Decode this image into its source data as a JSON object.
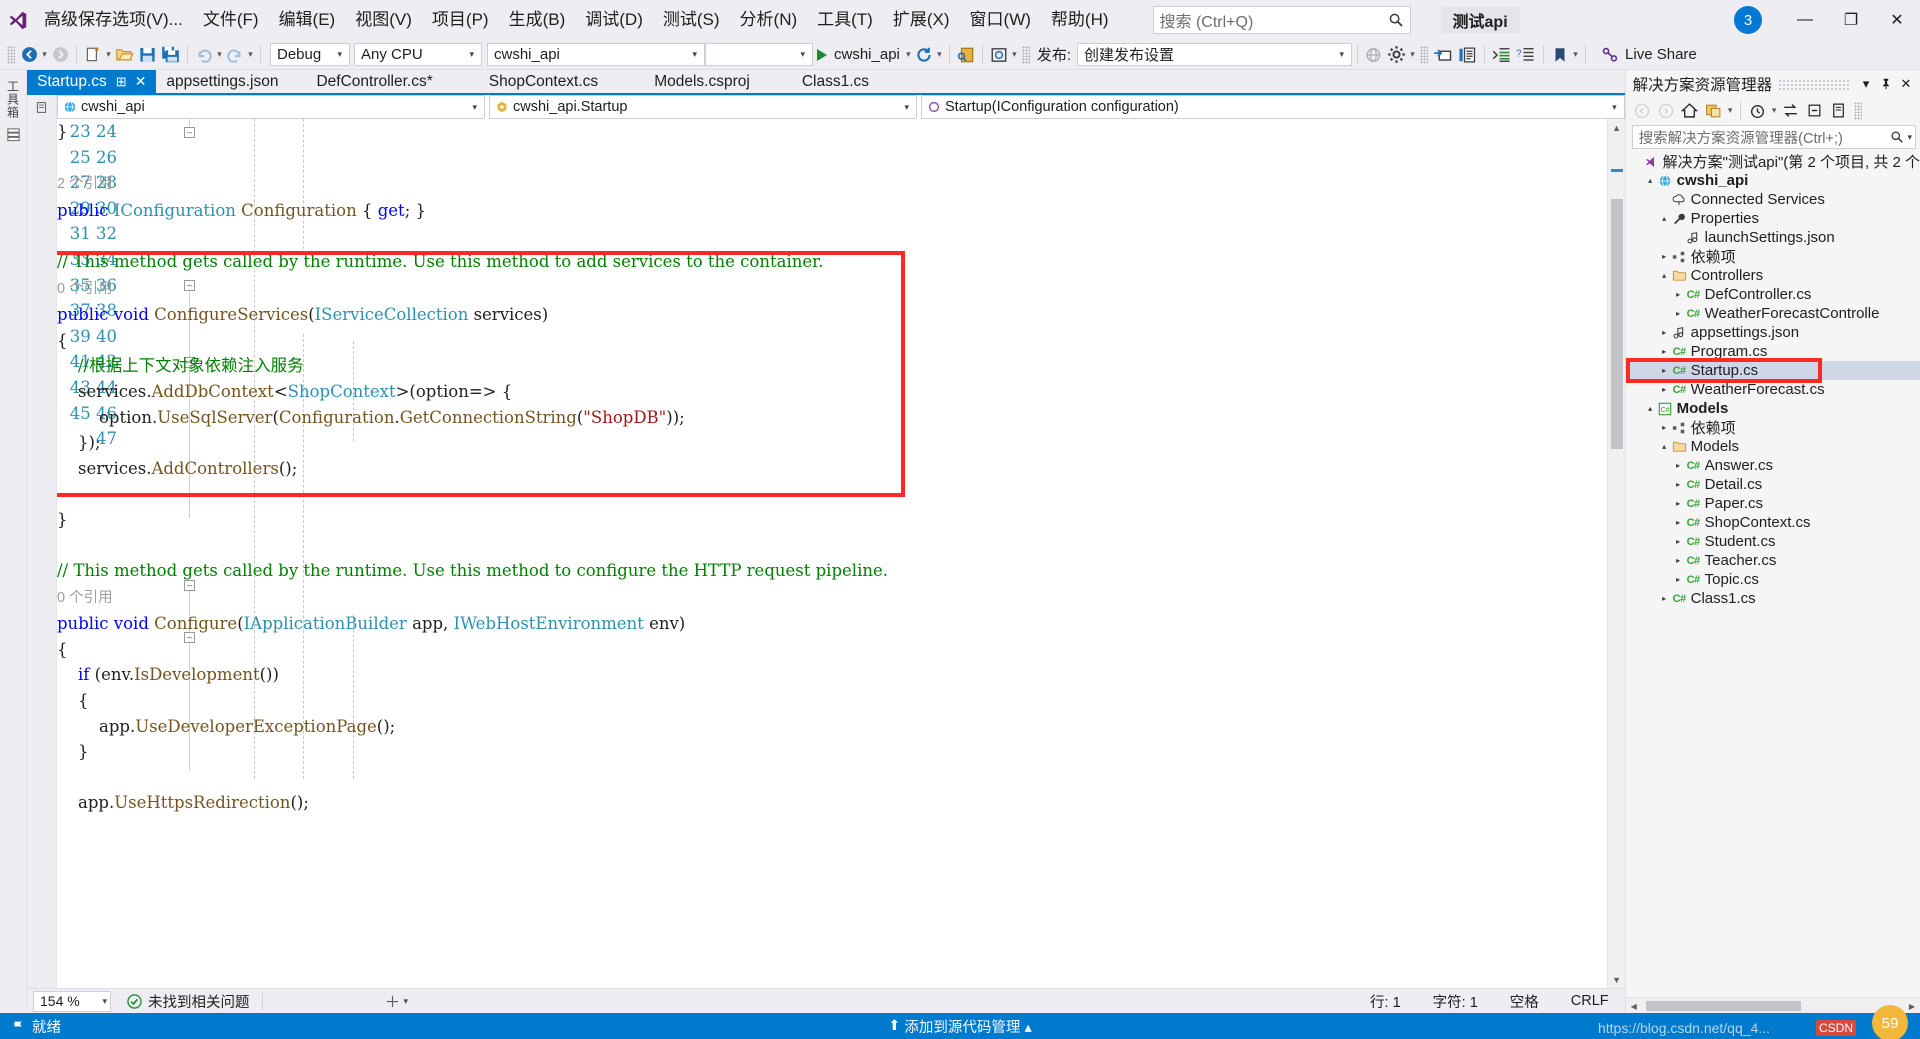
{
  "window": {
    "menu": [
      {
        "label": "高级保存选项(V)...",
        "accel": ""
      },
      {
        "label": "文件(F)",
        "accel": ""
      },
      {
        "label": "编辑(E)",
        "accel": ""
      },
      {
        "label": "视图(V)",
        "accel": ""
      },
      {
        "label": "项目(P)",
        "accel": ""
      },
      {
        "label": "生成(B)",
        "accel": ""
      },
      {
        "label": "调试(D)",
        "accel": ""
      },
      {
        "label": "测试(S)",
        "accel": ""
      },
      {
        "label": "分析(N)",
        "accel": ""
      },
      {
        "label": "工具(T)",
        "accel": ""
      },
      {
        "label": "扩展(X)",
        "accel": ""
      },
      {
        "label": "窗口(W)",
        "accel": ""
      },
      {
        "label": "帮助(H)",
        "accel": ""
      }
    ],
    "search_placeholder": "搜索 (Ctrl+Q)",
    "solution_name": "测试api",
    "account_initial": "3",
    "minimize": "—",
    "maximize": "❐",
    "close": "✕"
  },
  "toolbar": {
    "config": "Debug",
    "platform": "Any CPU",
    "startup_project": "cwshi_api",
    "target_combo": "",
    "run_label": "cwshi_api",
    "publish_label": "发布:",
    "publish_value": "创建发布设置",
    "live_share": "Live Share"
  },
  "tabs": [
    {
      "label": "Startup.cs",
      "active": true,
      "pin": "⊞",
      "close": "✕"
    },
    {
      "label": "appsettings.json",
      "active": false
    },
    {
      "label": "DefController.cs*",
      "active": false
    },
    {
      "label": "ShopContext.cs",
      "active": false
    },
    {
      "label": "Models.csproj",
      "active": false
    },
    {
      "label": "Class1.cs",
      "active": false
    }
  ],
  "navbar": {
    "project": "cwshi_api",
    "type": "cwshi_api.Startup",
    "member": "Startup(IConfiguration configuration)"
  },
  "code": {
    "line_start": 23,
    "lines": [
      {
        "num": "23",
        "text": "        }"
      },
      {
        "num": "24",
        "text": ""
      },
      {
        "num": "",
        "text": "        2 个引用",
        "lens": true
      },
      {
        "num": "25",
        "text": "        public IConfiguration Configuration { get; }"
      },
      {
        "num": "26",
        "text": ""
      },
      {
        "num": "27",
        "text": "        // This method gets called by the runtime. Use this method to add services to the container."
      },
      {
        "num": "",
        "text": "        0 个引用",
        "lens": true
      },
      {
        "num": "28",
        "text": "        public void ConfigureServices(IServiceCollection services)"
      },
      {
        "num": "29",
        "text": "        {"
      },
      {
        "num": "30",
        "text": "            //根据上下文对象依赖注入服务"
      },
      {
        "num": "31",
        "text": "            services.AddDbContext<ShopContext>(option=> {"
      },
      {
        "num": "32",
        "text": "                option.UseSqlServer(Configuration.GetConnectionString(\"ShopDB\"));"
      },
      {
        "num": "33",
        "text": "            });"
      },
      {
        "num": "34",
        "text": "            services.AddControllers();"
      },
      {
        "num": "35",
        "text": ""
      },
      {
        "num": "36",
        "text": "        }"
      },
      {
        "num": "37",
        "text": ""
      },
      {
        "num": "38",
        "text": "        // This method gets called by the runtime. Use this method to configure the HTTP request pipeline."
      },
      {
        "num": "",
        "text": "        0 个引用",
        "lens": true
      },
      {
        "num": "39",
        "text": "        public void Configure(IApplicationBuilder app, IWebHostEnvironment env)"
      },
      {
        "num": "40",
        "text": "        {"
      },
      {
        "num": "41",
        "text": "            if (env.IsDevelopment())"
      },
      {
        "num": "42",
        "text": "            {"
      },
      {
        "num": "43",
        "text": "                app.UseDeveloperExceptionPage();"
      },
      {
        "num": "44",
        "text": "            }"
      },
      {
        "num": "45",
        "text": ""
      },
      {
        "num": "46",
        "text": "            app.UseHttpsRedirection();"
      },
      {
        "num": "47",
        "text": ""
      }
    ]
  },
  "editor_status": {
    "zoom": "154 %",
    "problems": "未找到相关问题",
    "line_label": "行: 1",
    "col_label": "字符: 1",
    "spaces": "空格",
    "eol": "CRLF"
  },
  "solution_explorer": {
    "title": "解决方案资源管理器",
    "search_placeholder": "搜索解决方案资源管理器(Ctrl+;)",
    "tree": [
      {
        "label": "解决方案\"测试api\"(第 2 个项目, 共 2 个",
        "depth": 0,
        "twisty": "",
        "icon": "solution",
        "bold": false
      },
      {
        "label": "cwshi_api",
        "depth": 1,
        "twisty": "▴",
        "icon": "project",
        "bold": true
      },
      {
        "label": "Connected Services",
        "depth": 2,
        "twisty": "",
        "icon": "connected",
        "bold": false
      },
      {
        "label": "Properties",
        "depth": 2,
        "twisty": "▴",
        "icon": "wrench",
        "bold": false
      },
      {
        "label": "launchSettings.json",
        "depth": 3,
        "twisty": "",
        "icon": "json",
        "bold": false
      },
      {
        "label": "依赖项",
        "depth": 2,
        "twisty": "▸",
        "icon": "deps",
        "bold": false
      },
      {
        "label": "Controllers",
        "depth": 2,
        "twisty": "▴",
        "icon": "folder",
        "bold": false
      },
      {
        "label": "DefController.cs",
        "depth": 3,
        "twisty": "▸",
        "icon": "cs",
        "bold": false
      },
      {
        "label": "WeatherForecastControlle",
        "depth": 3,
        "twisty": "▸",
        "icon": "cs",
        "bold": false
      },
      {
        "label": "appsettings.json",
        "depth": 2,
        "twisty": "▸",
        "icon": "json",
        "bold": false
      },
      {
        "label": "Program.cs",
        "depth": 2,
        "twisty": "▸",
        "icon": "cs",
        "bold": false
      },
      {
        "label": "Startup.cs",
        "depth": 2,
        "twisty": "▸",
        "icon": "cs",
        "bold": false,
        "selected": true,
        "annotated": true
      },
      {
        "label": "WeatherForecast.cs",
        "depth": 2,
        "twisty": "▸",
        "icon": "cs",
        "bold": false
      },
      {
        "label": "Models",
        "depth": 1,
        "twisty": "▴",
        "icon": "csproj",
        "bold": true
      },
      {
        "label": "依赖项",
        "depth": 2,
        "twisty": "▸",
        "icon": "deps",
        "bold": false
      },
      {
        "label": "Models",
        "depth": 2,
        "twisty": "▴",
        "icon": "folder",
        "bold": false
      },
      {
        "label": "Answer.cs",
        "depth": 3,
        "twisty": "▸",
        "icon": "cs",
        "bold": false
      },
      {
        "label": "Detail.cs",
        "depth": 3,
        "twisty": "▸",
        "icon": "cs",
        "bold": false
      },
      {
        "label": "Paper.cs",
        "depth": 3,
        "twisty": "▸",
        "icon": "cs",
        "bold": false
      },
      {
        "label": "ShopContext.cs",
        "depth": 3,
        "twisty": "▸",
        "icon": "cs",
        "bold": false
      },
      {
        "label": "Student.cs",
        "depth": 3,
        "twisty": "▸",
        "icon": "cs",
        "bold": false
      },
      {
        "label": "Teacher.cs",
        "depth": 3,
        "twisty": "▸",
        "icon": "cs",
        "bold": false
      },
      {
        "label": "Topic.cs",
        "depth": 3,
        "twisty": "▸",
        "icon": "cs",
        "bold": false
      },
      {
        "label": "Class1.cs",
        "depth": 2,
        "twisty": "▸",
        "icon": "cs",
        "bold": false
      }
    ]
  },
  "statusbar": {
    "state": "就绪",
    "center_text": "添加到源代码管理 ▴",
    "watermark": "https://blog.csdn.net/qq_4...",
    "badge": "CSDN",
    "counter": "59"
  },
  "colors": {
    "accent": "#007acc",
    "annotation": "#fc2a21",
    "keyword": "#0000ff",
    "type": "#2b91af",
    "string": "#a31515",
    "comment": "#008000",
    "method": "#74531f",
    "linenum": "#2b91af"
  }
}
